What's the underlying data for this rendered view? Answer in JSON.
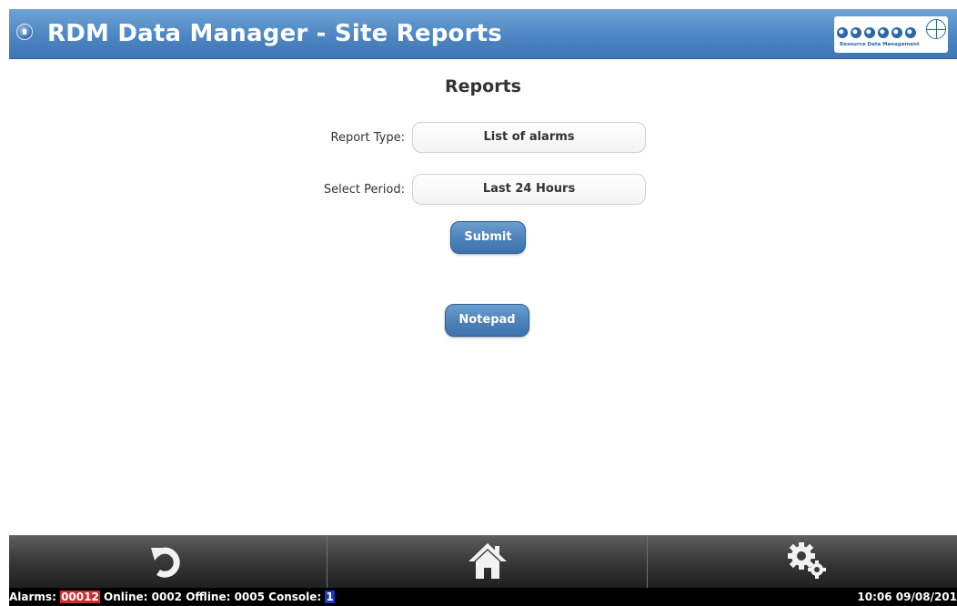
{
  "header": {
    "title": "RDM Data Manager - Site Reports",
    "logo_text": "Resource Data Management"
  },
  "main": {
    "heading": "Reports",
    "report_type": {
      "label": "Report Type:",
      "value": "List of alarms"
    },
    "period": {
      "label": "Select Period:",
      "value": "Last 24 Hours"
    },
    "submit_label": "Submit",
    "notepad_label": "Notepad"
  },
  "toolbar": {
    "items": [
      {
        "icon": "back-icon"
      },
      {
        "icon": "home-icon"
      },
      {
        "icon": "settings-gears-icon"
      }
    ]
  },
  "status": {
    "alarms_label": "Alarms:",
    "alarms_value": "00012",
    "online_text": "Online: 0002",
    "offline_text": "Offline: 0005",
    "console_label": "Console:",
    "console_value": "1",
    "datetime": "10:06 09/08/201",
    "colors": {
      "alarm": "#d12b2b",
      "console": "#1a37c8"
    }
  }
}
